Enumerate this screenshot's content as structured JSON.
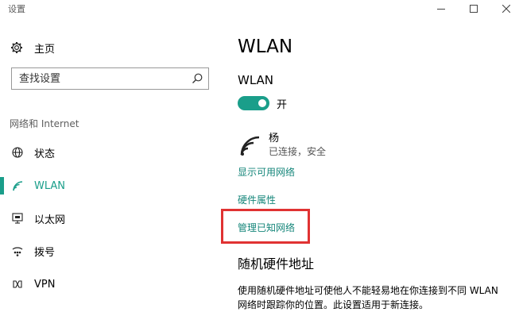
{
  "window": {
    "title": "设置",
    "controls": [
      "minimize",
      "maximize",
      "close"
    ]
  },
  "sidebar": {
    "home_label": "主页",
    "search": {
      "placeholder": "查找设置"
    },
    "section_heading": "网络和 Internet",
    "items": [
      {
        "label": "状态",
        "icon": "status-globe-icon",
        "active": false
      },
      {
        "label": "WLAN",
        "icon": "wifi-icon",
        "active": true
      },
      {
        "label": "以太网",
        "icon": "ethernet-icon",
        "active": false
      },
      {
        "label": "拨号",
        "icon": "dialup-icon",
        "active": false
      },
      {
        "label": "VPN",
        "icon": "vpn-icon",
        "active": false
      }
    ]
  },
  "main": {
    "title": "WLAN",
    "wlan_label": "WLAN",
    "toggle": {
      "on": true,
      "state_label": "开"
    },
    "network": {
      "name": "杨",
      "status": "已连接，安全"
    },
    "links": {
      "show_available": "显示可用网络",
      "hardware_props": "硬件属性",
      "manage_known": "管理已知网络"
    },
    "random_hw_heading": "随机硬件地址",
    "random_hw_desc": "使用随机硬件地址可使他人不能轻易地在你连接到不同 WLAN 网络时跟踪你的位置。此设置适用于新连接。"
  },
  "colors": {
    "accent": "#1a9e8a",
    "link": "#15867a",
    "highlight": "#e03232"
  }
}
